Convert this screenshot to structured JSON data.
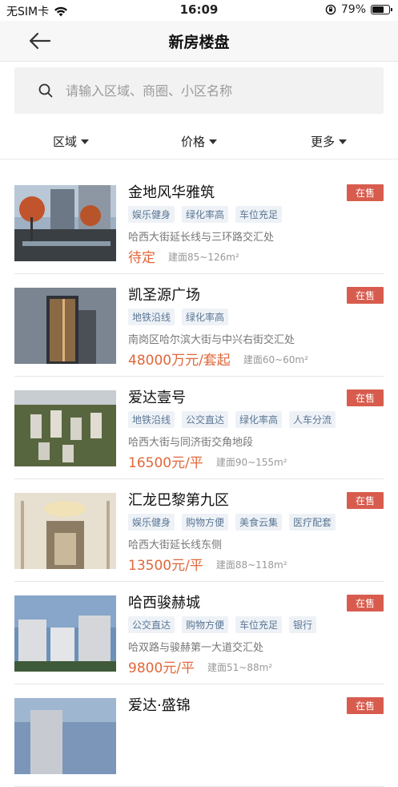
{
  "status": {
    "carrier": "无SIM卡",
    "time": "16:09",
    "battery": "79%",
    "battery_level": 0.79
  },
  "nav": {
    "title": "新房楼盘"
  },
  "search": {
    "placeholder": "请输入区域、商圈、小区名称"
  },
  "filters": [
    {
      "label": "区域"
    },
    {
      "label": "价格"
    },
    {
      "label": "更多"
    }
  ],
  "listings": [
    {
      "name": "金地风华雅筑",
      "status": "在售",
      "tags": [
        "娱乐健身",
        "绿化率高",
        "车位充足"
      ],
      "address": "哈西大街延长线与三环路交汇处",
      "price": "待定",
      "area": "建面85~126m²"
    },
    {
      "name": "凯圣源广场",
      "status": "在售",
      "tags": [
        "地铁沿线",
        "绿化率高"
      ],
      "address": "南岗区哈尔滨大街与中兴右街交汇处",
      "price": "48000万元/套起",
      "area": "建面60~60m²"
    },
    {
      "name": "爱达壹号",
      "status": "在售",
      "tags": [
        "地铁沿线",
        "公交直达",
        "绿化率高",
        "人车分流"
      ],
      "address": "哈西大街与同济街交角地段",
      "price": "16500元/平",
      "area": "建面90~155m²"
    },
    {
      "name": "汇龙巴黎第九区",
      "status": "在售",
      "tags": [
        "娱乐健身",
        "购物方便",
        "美食云集",
        "医疗配套"
      ],
      "address": "哈西大街延长线东侧",
      "price": "13500元/平",
      "area": "建面88~118m²"
    },
    {
      "name": "哈西骏赫城",
      "status": "在售",
      "tags": [
        "公交直达",
        "购物方便",
        "车位充足",
        "银行"
      ],
      "address": "哈双路与骏赫第一大道交汇处",
      "price": "9800元/平",
      "area": "建面51~88m²"
    },
    {
      "name": "爱达·盛锦",
      "status": "在售",
      "tags": [],
      "address": "",
      "price": "",
      "area": ""
    }
  ]
}
